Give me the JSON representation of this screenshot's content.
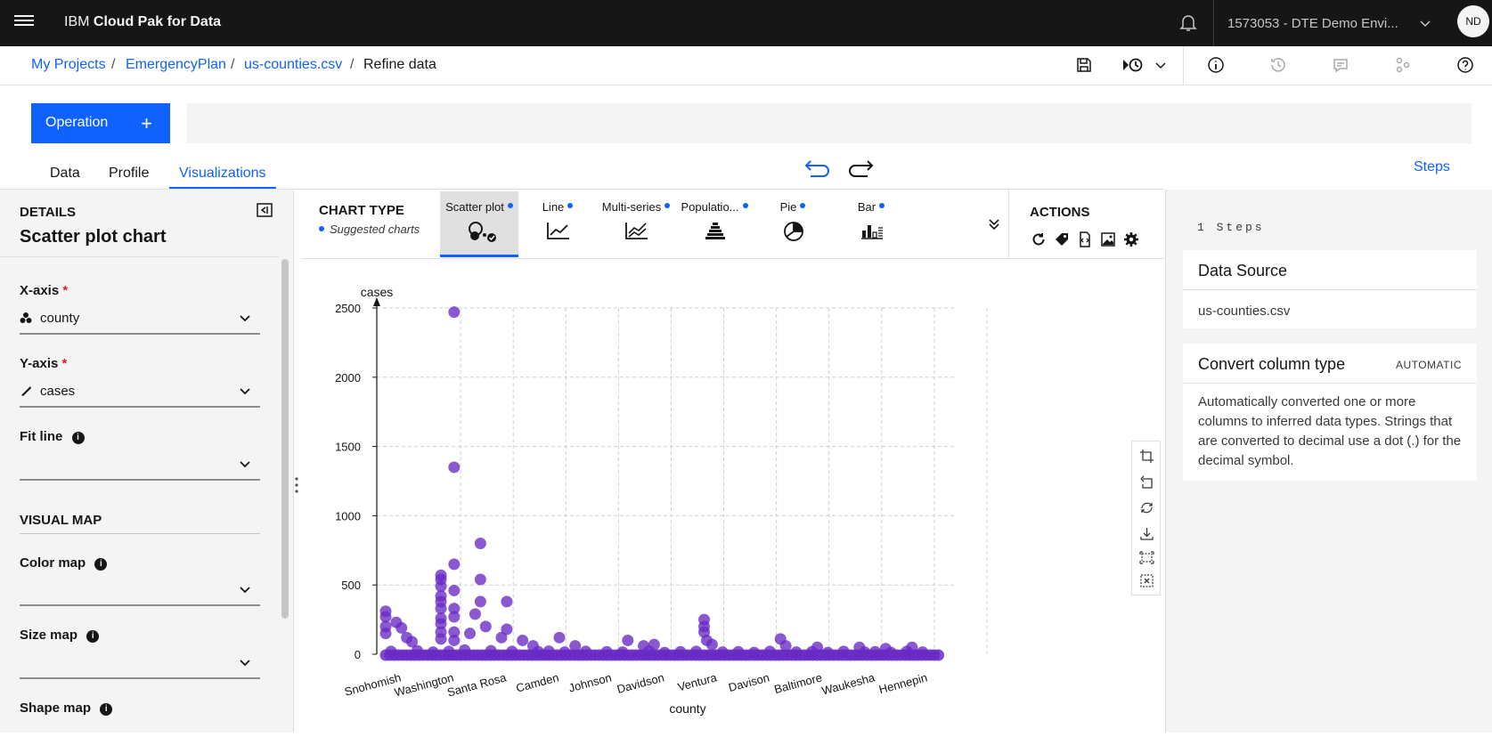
{
  "app": {
    "brand_prefix": "IBM",
    "brand_name": "Cloud Pak for Data",
    "account": "1573053 - DTE Demo Envi...",
    "avatar_initials": "ND"
  },
  "breadcrumb": {
    "items": [
      "My Projects",
      "EmergencyPlan",
      "us-counties.csv"
    ],
    "current": "Refine data"
  },
  "operation": {
    "label": "Operation",
    "plus": "+"
  },
  "tabs": [
    {
      "label": "Data",
      "active": false
    },
    {
      "label": "Profile",
      "active": false
    },
    {
      "label": "Visualizations",
      "active": true
    }
  ],
  "steps_link": "Steps",
  "details": {
    "header": "DETAILS",
    "title": "Scatter plot chart",
    "x_axis": {
      "label": "X-axis",
      "value": "county"
    },
    "y_axis": {
      "label": "Y-axis",
      "value": "cases"
    },
    "fit_line": {
      "label": "Fit line",
      "value": ""
    },
    "visual_map_header": "VISUAL MAP",
    "color_map": {
      "label": "Color map",
      "value": ""
    },
    "size_map": {
      "label": "Size map",
      "value": ""
    },
    "shape_map": {
      "label": "Shape map"
    },
    "required_mark": "*",
    "info_glyph": "i"
  },
  "chart_type": {
    "header": "CHART TYPE",
    "suggested": "Suggested charts",
    "types": [
      {
        "label": "Scatter plot",
        "icon": "scatter-plot-icon",
        "active": true
      },
      {
        "label": "Line",
        "icon": "line-chart-icon",
        "active": false
      },
      {
        "label": "Multi-series",
        "icon": "multi-series-icon",
        "active": false
      },
      {
        "label": "Populatio...",
        "icon": "population-pyramid-icon",
        "active": false
      },
      {
        "label": "Pie",
        "icon": "pie-chart-icon",
        "active": false
      },
      {
        "label": "Bar",
        "icon": "bar-chart-icon",
        "active": false
      }
    ]
  },
  "actions": {
    "header": "ACTIONS"
  },
  "right_panel": {
    "steps_count": "1 Steps",
    "data_source": {
      "title": "Data Source",
      "value": "us-counties.csv"
    },
    "convert": {
      "title": "Convert column type",
      "badge": "AUTOMATIC",
      "description": "Automatically converted one or more columns to inferred data types. Strings that are converted to decimal use a dot (.) for the decimal symbol."
    }
  },
  "colors": {
    "accent": "#0f62fe",
    "point": "#6929c4",
    "topbar": "#161616"
  },
  "chart_data": {
    "type": "scatter",
    "xlabel": "county",
    "ylabel": "cases",
    "ylim": [
      0,
      2500
    ],
    "yticks": [
      0,
      500,
      1000,
      1500,
      2000,
      2500
    ],
    "x_tick_labels": [
      "Snohomish",
      "Washington",
      "Santa Rosa",
      "Camden",
      "Johnson",
      "Davidson",
      "Ventura",
      "Davison",
      "Baltimore",
      "Waukesha",
      "Hennepin"
    ],
    "grid": true,
    "series": [
      {
        "points": [
          [
            0,
            310
          ],
          [
            0,
            270
          ],
          [
            0,
            200
          ],
          [
            0,
            150
          ],
          [
            0.2,
            230
          ],
          [
            0.3,
            190
          ],
          [
            0.4,
            120
          ],
          [
            0.5,
            90
          ],
          [
            1.05,
            570
          ],
          [
            1.05,
            540
          ],
          [
            1.05,
            490
          ],
          [
            1.05,
            420
          ],
          [
            1.05,
            380
          ],
          [
            1.05,
            330
          ],
          [
            1.05,
            260
          ],
          [
            1.05,
            220
          ],
          [
            1.05,
            160
          ],
          [
            1.05,
            110
          ],
          [
            1.3,
            2470
          ],
          [
            1.3,
            1350
          ],
          [
            1.3,
            650
          ],
          [
            1.3,
            460
          ],
          [
            1.3,
            330
          ],
          [
            1.3,
            270
          ],
          [
            1.3,
            160
          ],
          [
            1.3,
            100
          ],
          [
            1.8,
            800
          ],
          [
            1.8,
            540
          ],
          [
            1.8,
            380
          ],
          [
            1.7,
            290
          ],
          [
            1.9,
            200
          ],
          [
            1.6,
            150
          ],
          [
            2.3,
            380
          ],
          [
            2.3,
            180
          ],
          [
            2.2,
            120
          ],
          [
            2.6,
            100
          ],
          [
            2.8,
            60
          ],
          [
            3.3,
            120
          ],
          [
            3.6,
            60
          ],
          [
            4.6,
            100
          ],
          [
            4.9,
            60
          ],
          [
            5.1,
            70
          ],
          [
            6.05,
            250
          ],
          [
            6.05,
            200
          ],
          [
            6.05,
            160
          ],
          [
            6.1,
            100
          ],
          [
            6.2,
            70
          ],
          [
            7.5,
            110
          ],
          [
            7.6,
            60
          ],
          [
            8.2,
            50
          ],
          [
            9.0,
            50
          ],
          [
            9.5,
            40
          ],
          [
            10.0,
            50
          ],
          [
            0.1,
            20
          ],
          [
            0.6,
            25
          ],
          [
            0.9,
            15
          ],
          [
            1.2,
            20
          ],
          [
            1.5,
            30
          ],
          [
            2.0,
            25
          ],
          [
            2.4,
            20
          ],
          [
            2.9,
            18
          ],
          [
            3.1,
            22
          ],
          [
            3.4,
            15
          ],
          [
            3.8,
            20
          ],
          [
            4.2,
            18
          ],
          [
            4.5,
            15
          ],
          [
            5.0,
            22
          ],
          [
            5.3,
            12
          ],
          [
            5.6,
            18
          ],
          [
            5.9,
            20
          ],
          [
            6.4,
            15
          ],
          [
            6.7,
            18
          ],
          [
            7.0,
            12
          ],
          [
            7.3,
            20
          ],
          [
            7.8,
            15
          ],
          [
            8.1,
            18
          ],
          [
            8.4,
            12
          ],
          [
            8.7,
            20
          ],
          [
            9.1,
            15
          ],
          [
            9.3,
            18
          ],
          [
            9.6,
            12
          ],
          [
            9.9,
            20
          ],
          [
            10.2,
            15
          ]
        ]
      }
    ]
  }
}
